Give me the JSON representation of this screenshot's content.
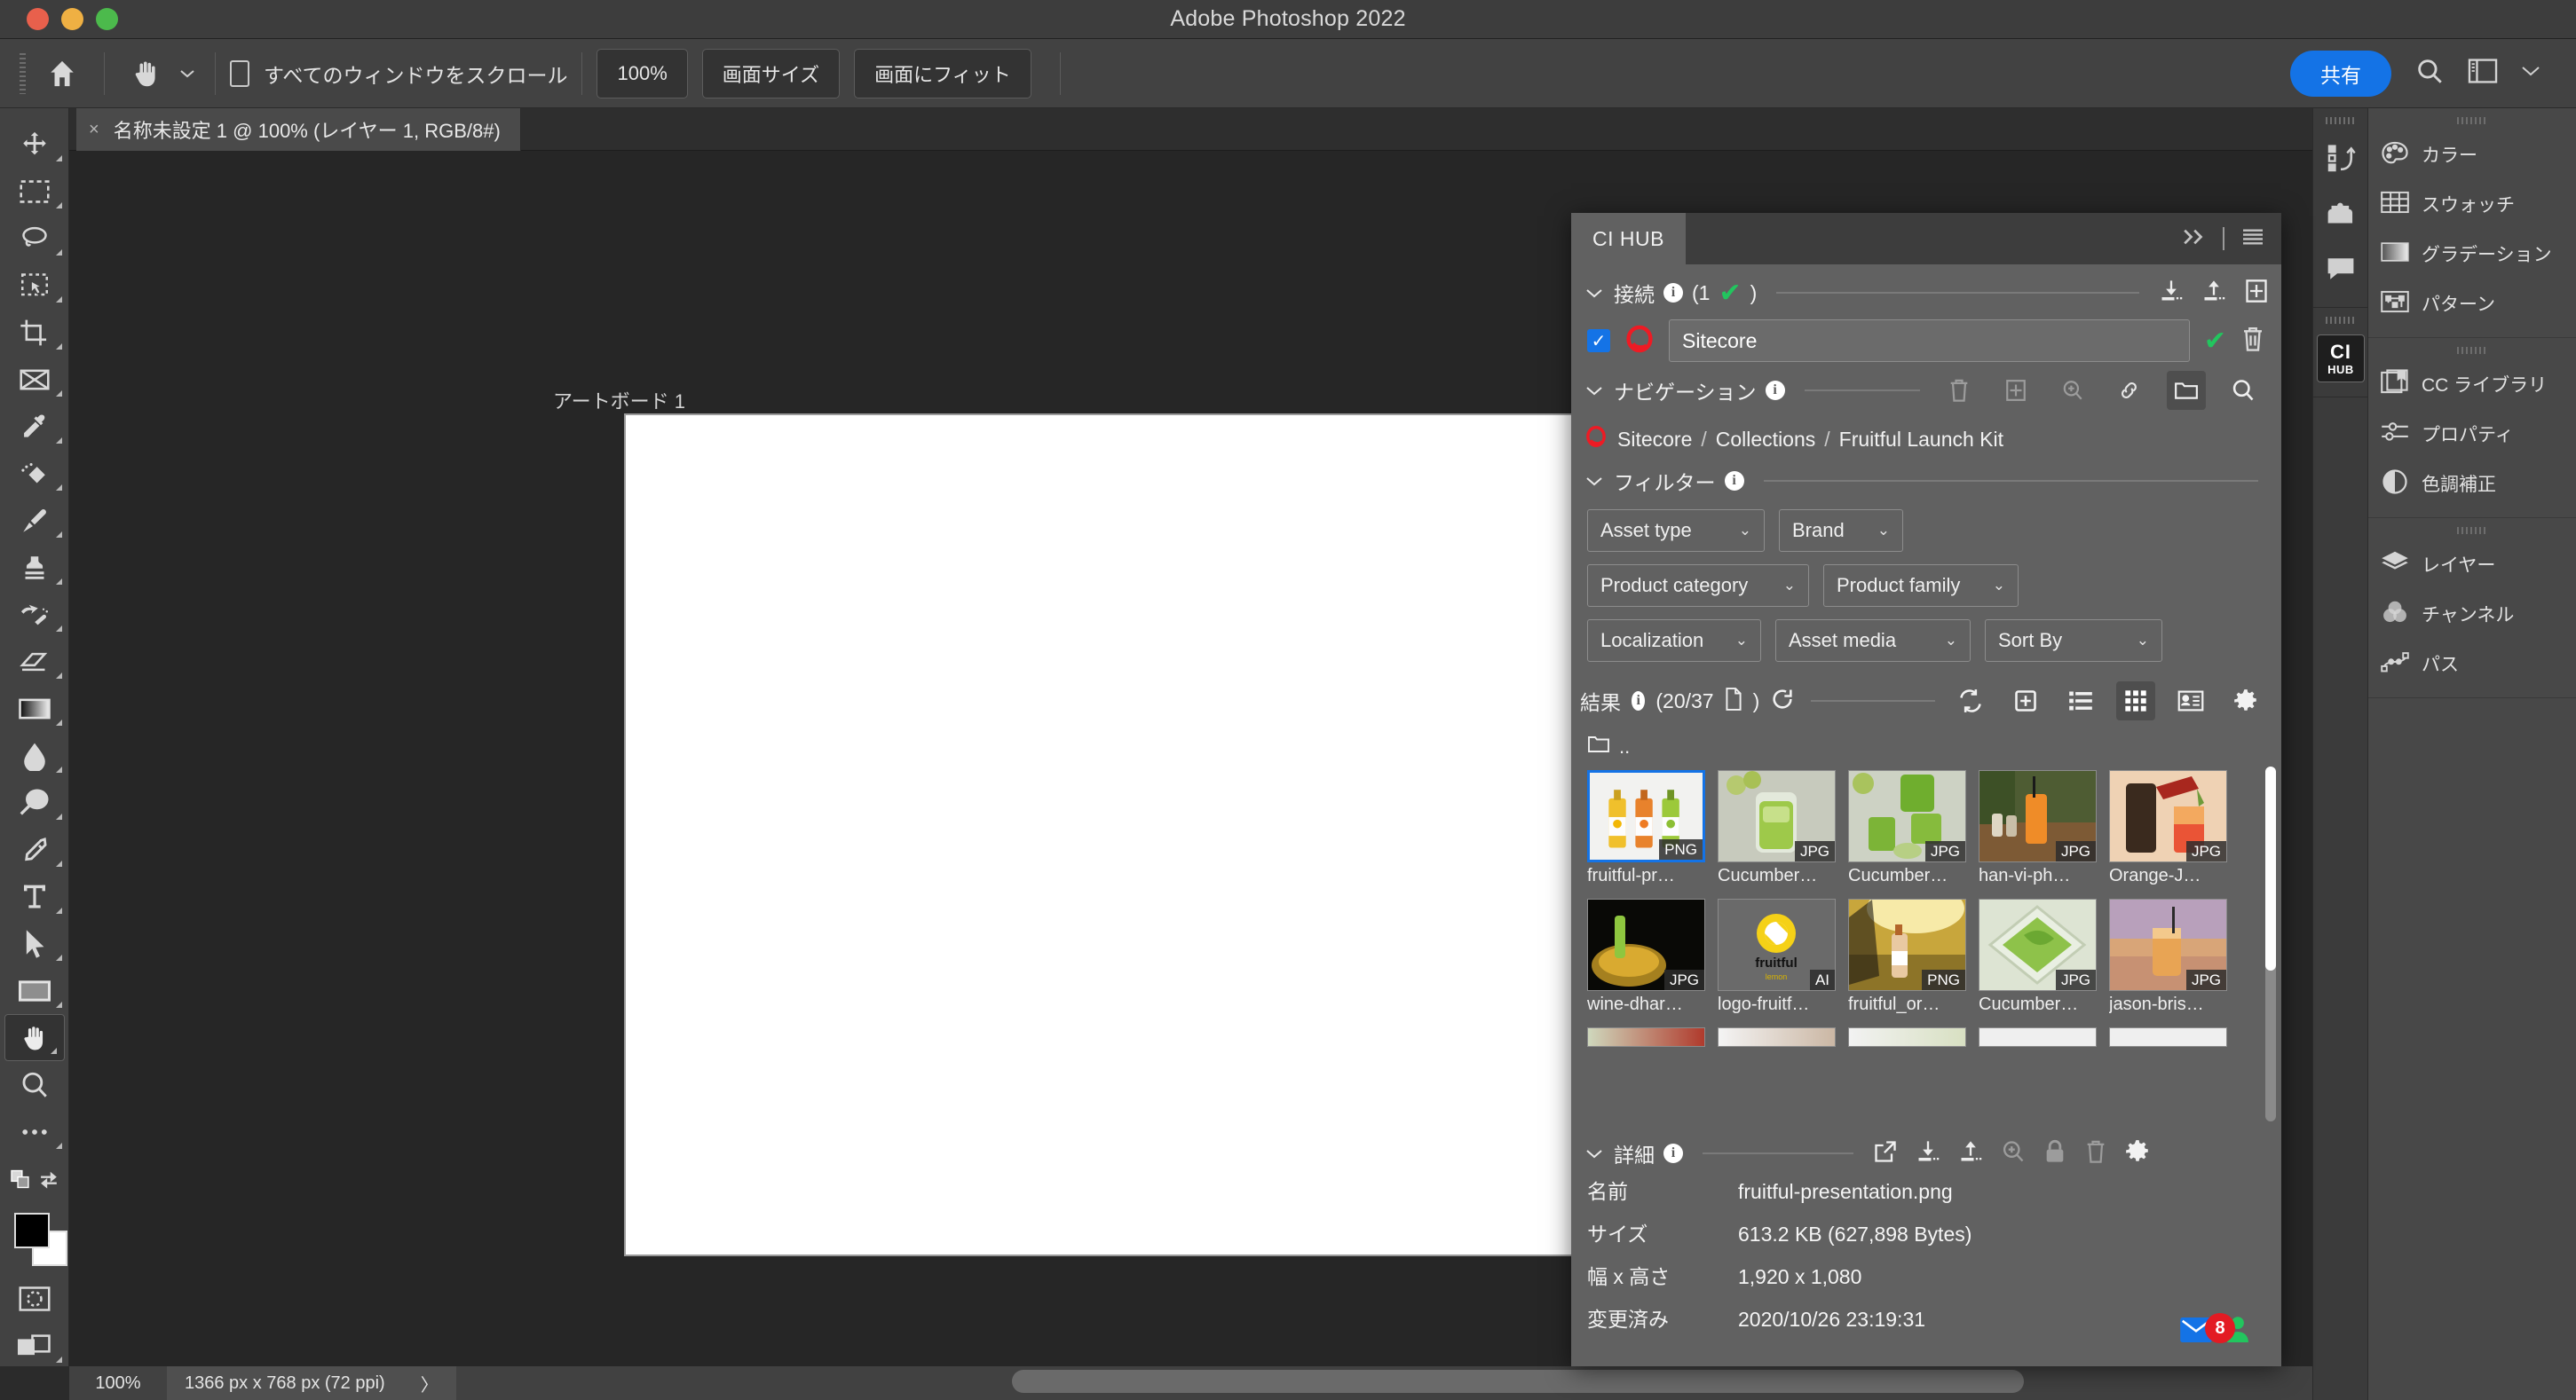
{
  "window": {
    "title": "Adobe Photoshop 2022",
    "traffic_lights": [
      "close",
      "minimize",
      "zoom"
    ]
  },
  "options_bar": {
    "home_icon": "home-icon",
    "tool_icon": "hand-tool-icon",
    "scroll_all_windows_label": "すべてのウィンドウをスクロール",
    "zoom_100_label": "100%",
    "screen_size_label": "画面サイズ",
    "fit_screen_label": "画面にフィット",
    "share_label": "共有",
    "search_icon": "search-icon",
    "workspace_icon": "workspace-icon",
    "chevron_icon": "chevron-down-icon"
  },
  "document_tab": {
    "close_glyph": "×",
    "label": "名称未設定 1 @ 100% (レイヤー 1, RGB/8#)"
  },
  "toolbar": {
    "tools": [
      {
        "name": "move-tool",
        "icon": "move-icon"
      },
      {
        "name": "marquee-tool",
        "icon": "rectangular-marquee-icon"
      },
      {
        "name": "lasso-tool",
        "icon": "lasso-icon"
      },
      {
        "name": "object-selection-tool",
        "icon": "object-selection-icon"
      },
      {
        "name": "crop-tool",
        "icon": "crop-icon"
      },
      {
        "name": "frame-tool",
        "icon": "frame-icon"
      },
      {
        "name": "eyedropper-tool",
        "icon": "eyedropper-icon"
      },
      {
        "name": "healing-brush-tool",
        "icon": "spot-healing-icon"
      },
      {
        "name": "brush-tool",
        "icon": "brush-icon"
      },
      {
        "name": "clone-stamp-tool",
        "icon": "clone-stamp-icon"
      },
      {
        "name": "history-brush-tool",
        "icon": "history-brush-icon"
      },
      {
        "name": "eraser-tool",
        "icon": "eraser-icon"
      },
      {
        "name": "gradient-tool",
        "icon": "gradient-icon"
      },
      {
        "name": "blur-tool",
        "icon": "blur-drop-icon"
      },
      {
        "name": "dodge-tool",
        "icon": "dodge-icon"
      },
      {
        "name": "pen-tool",
        "icon": "pen-icon"
      },
      {
        "name": "type-tool",
        "icon": "type-t-icon"
      },
      {
        "name": "path-selection-tool",
        "icon": "path-arrow-icon"
      },
      {
        "name": "shape-tool",
        "icon": "rectangle-shape-icon"
      },
      {
        "name": "hand-tool",
        "icon": "hand-icon",
        "selected": true
      },
      {
        "name": "zoom-tool",
        "icon": "magnifier-icon"
      },
      {
        "name": "more-tools",
        "icon": "ellipsis-icon"
      }
    ],
    "foreground_color": "#000000",
    "background_color": "#ffffff",
    "quick_mask_icon": "quick-mask-icon",
    "screen_mode_icon": "screen-mode-icon"
  },
  "canvas": {
    "artboard_label": "アートボード 1",
    "artboard_fill": "#ffffff"
  },
  "status_bar": {
    "zoom": "100%",
    "doc_size": "1366 px x 768 px (72 ppi)",
    "chevron": "〉"
  },
  "dock_icons": [
    {
      "name": "history-icon",
      "label": "history"
    },
    {
      "name": "plugins-icon",
      "label": "plugins"
    },
    {
      "name": "comments-icon",
      "label": "comments"
    },
    {
      "name": "cihub-icon",
      "label_top": "CI",
      "label_bottom": "HUB",
      "selected": true
    }
  ],
  "dock_panels": [
    {
      "name": "color-panel",
      "icon": "palette-icon",
      "label": "カラー"
    },
    {
      "name": "swatches-panel",
      "icon": "swatches-grid-icon",
      "label": "スウォッチ"
    },
    {
      "name": "gradients-panel",
      "icon": "gradient-swatch-icon",
      "label": "グラデーション"
    },
    {
      "name": "patterns-panel",
      "icon": "pattern-icon",
      "label": "パターン"
    },
    {
      "name": "cc-libraries-panel",
      "icon": "cc-library-icon",
      "label": "CC ライブラリ"
    },
    {
      "name": "properties-panel",
      "icon": "sliders-icon",
      "label": "プロパティ"
    },
    {
      "name": "adjustments-panel",
      "icon": "half-circle-icon",
      "label": "色調補正"
    },
    {
      "name": "layers-panel",
      "icon": "layers-icon",
      "label": "レイヤー"
    },
    {
      "name": "channels-panel",
      "icon": "channels-venn-icon",
      "label": "チャンネル"
    },
    {
      "name": "paths-panel",
      "icon": "paths-bezier-icon",
      "label": "パス"
    }
  ],
  "cihub": {
    "panel_title": "CI HUB",
    "header_collapse_icon": "double-chevron-right-icon",
    "header_menu_icon": "hamburger-menu-icon",
    "connections": {
      "title": "接続",
      "count_text": "(1",
      "count_close": ")",
      "actions": [
        "download-icon",
        "upload-icon",
        "add-panel-icon"
      ],
      "row": {
        "checkbox_checked": true,
        "provider_icon": "sitecore-logo-icon",
        "value": "Sitecore",
        "confirm_icon": "green-check-icon",
        "delete_icon": "trash-icon"
      }
    },
    "navigation": {
      "title": "ナビゲーション",
      "actions": [
        "trash-icon",
        "add-icon",
        "zoom-in-icon",
        "link-icon",
        "folder-icon",
        "search-icon"
      ],
      "active_action": "folder-icon",
      "breadcrumb": [
        "Sitecore",
        "Collections",
        "Fruitful Launch Kit"
      ],
      "breadcrumb_separator": "/"
    },
    "filters": {
      "title": "フィルター",
      "row1": [
        "Asset type",
        "Brand"
      ],
      "row2": [
        "Product category",
        "Product family"
      ],
      "row3": [
        "Localization",
        "Asset media",
        "Sort By"
      ]
    },
    "results": {
      "title": "結果",
      "count_text": "(20/37",
      "count_close": ")",
      "refresh_icon": "refresh-circular-icon",
      "actions": [
        {
          "name": "sync-icon",
          "active": false
        },
        {
          "name": "add-box-icon",
          "active": false
        },
        {
          "name": "list-view-icon",
          "active": false
        },
        {
          "name": "grid-view-icon",
          "active": true
        },
        {
          "name": "card-view-icon",
          "active": false
        },
        {
          "name": "settings-gear-icon",
          "active": false
        }
      ],
      "up_folder_label": "..",
      "items": [
        {
          "name": "fruitful-pr…",
          "format": "PNG",
          "art": "t1",
          "selected": true
        },
        {
          "name": "Cucumber…",
          "format": "JPG",
          "art": "t2",
          "selected": false
        },
        {
          "name": "Cucumber…",
          "format": "JPG",
          "art": "t3",
          "selected": false
        },
        {
          "name": "han-vi-ph…",
          "format": "JPG",
          "art": "t4",
          "selected": false
        },
        {
          "name": "Orange-J…",
          "format": "JPG",
          "art": "t5",
          "selected": false
        },
        {
          "name": "wine-dhar…",
          "format": "JPG",
          "art": "t6",
          "selected": false
        },
        {
          "name": "logo-fruitf…",
          "format": "AI",
          "art": "t7",
          "selected": false
        },
        {
          "name": "fruitful_or…",
          "format": "PNG",
          "art": "t8",
          "selected": false
        },
        {
          "name": "Cucumber…",
          "format": "JPG",
          "art": "t9",
          "selected": false
        },
        {
          "name": "jason-bris…",
          "format": "JPG",
          "art": "t10",
          "selected": false
        }
      ]
    },
    "details": {
      "title": "詳細",
      "actions": [
        "open-external-icon",
        "download-icon",
        "upload-icon",
        "zoom-in-icon",
        "lock-icon",
        "trash-icon",
        "settings-gear-icon"
      ],
      "fields": [
        {
          "key": "名前",
          "value": "fruitful-presentation.png"
        },
        {
          "key": "サイズ",
          "value": "613.2 KB (627,898 Bytes)"
        },
        {
          "key": "幅 x 高さ",
          "value": "1,920 x 1,080"
        },
        {
          "key": "変更済み",
          "value": "2020/10/26 23:19:31"
        }
      ],
      "notification_count": "8",
      "notification_icon": "mail-envelope-icon",
      "user_icon": "user-person-icon"
    }
  },
  "colors": {
    "accent_blue": "#1473e6",
    "green_check": "#22c55e",
    "red_badge": "#e31b23",
    "panel_bg": "#616161"
  }
}
